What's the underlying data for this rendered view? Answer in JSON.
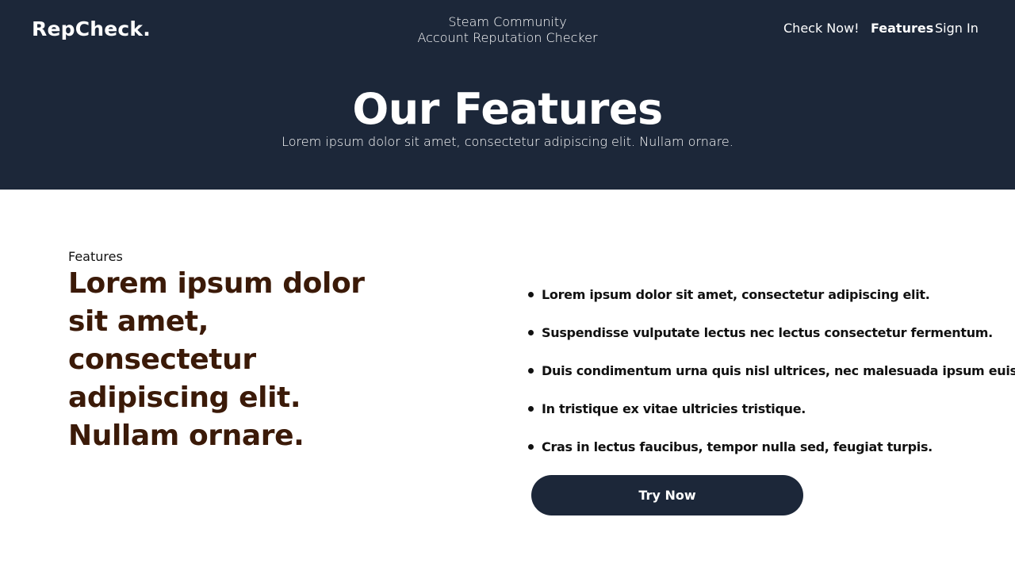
{
  "header": {
    "logo": "RepCheck.",
    "tagline_line1": "Steam Community",
    "tagline_line2": "Account Reputation Checker",
    "nav": [
      {
        "label": "Check Now!",
        "active": false
      },
      {
        "label": "Features",
        "active": true
      },
      {
        "label": "Sign In",
        "active": false
      }
    ]
  },
  "hero": {
    "title": "Our Features",
    "subtitle": "Lorem ipsum dolor sit amet, consectetur adipiscing elit. Nullam ornare."
  },
  "features": {
    "eyebrow": "Features",
    "headline": "Lorem ipsum dolor sit amet, consectetur adipiscing elit. Nullam ornare.",
    "items": [
      "Lorem ipsum dolor sit amet, consectetur adipiscing elit.",
      "Suspendisse vulputate lectus nec lectus consectetur fermentum.",
      "Duis condimentum urna quis nisl ultrices, nec malesuada ipsum euismod.",
      "In tristique ex vitae ultricies tristique.",
      "Cras in lectus faucibus, tempor nulla sed, feugiat turpis."
    ],
    "cta_label": "Try Now"
  },
  "colors": {
    "navy": "#1c2739",
    "headline_brown": "#3b1a08",
    "white": "#ffffff"
  }
}
